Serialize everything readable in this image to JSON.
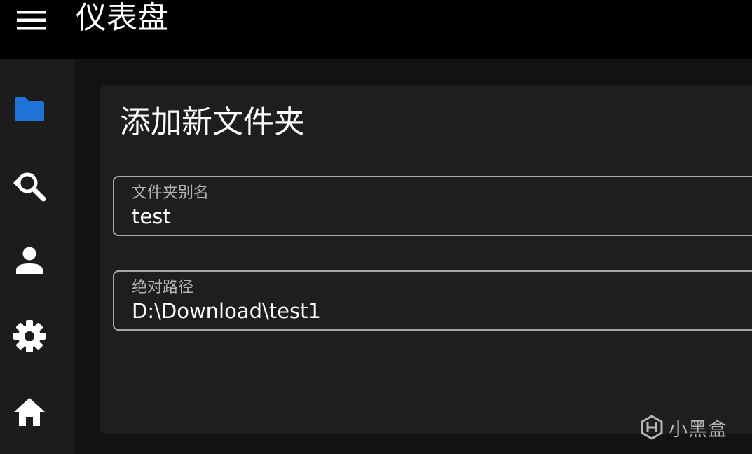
{
  "header": {
    "title": "仪表盘",
    "menu_icon": "hamburger-menu-icon"
  },
  "sidebar": {
    "items": [
      {
        "id": "folders",
        "icon": "folder-icon",
        "active": true
      },
      {
        "id": "search",
        "icon": "search-refresh-icon",
        "active": false
      },
      {
        "id": "user",
        "icon": "person-icon",
        "active": false
      },
      {
        "id": "settings",
        "icon": "gear-icon",
        "active": false
      },
      {
        "id": "home",
        "icon": "home-icon",
        "active": false
      }
    ]
  },
  "form": {
    "title": "添加新文件夹",
    "alias_label": "文件夹别名",
    "alias_value": "test",
    "path_label": "绝对路径",
    "path_value": "D:\\Download\\test1"
  },
  "watermark": {
    "text": "小黑盒"
  },
  "colors": {
    "accent": "#1e73d6",
    "topbar": "#000000",
    "sidebar": "#1c1c1c",
    "card": "#1e1e1e",
    "background": "#121212",
    "field_border": "#a8a8a8"
  }
}
